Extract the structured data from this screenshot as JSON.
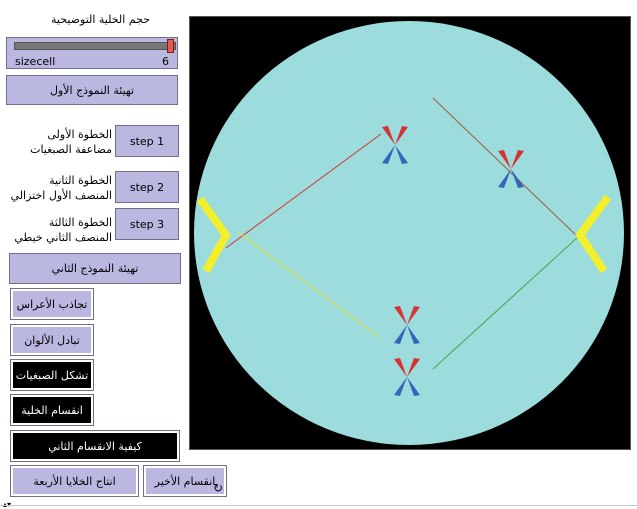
{
  "slider": {
    "title": "حجم الخلية التوضيحية",
    "variable": "sizecell",
    "value": "6",
    "fraction": 0.97
  },
  "buttons": {
    "setup_model_one": "تهيئة النموذج الأول",
    "step1": "step 1",
    "step2": "step 2",
    "step3": "step 3",
    "setup_model_two": "تهيئة النموذج الثاني",
    "attraction": "تجاذب الأعراس",
    "exchange_colors": "تبادل الألوان",
    "chromosome_formation": "تشكل الصبغيات",
    "cell_division": "انقسام الخلية",
    "second_division": "كيفية الانقسام الثاني",
    "last_division": "انقسام الأخير",
    "four_cells": "انتاج الخلايا الأربعة"
  },
  "step_labels": {
    "step1_line1": "الخطوة الأولى",
    "step1_line2": "مضاعفة الصبغيات",
    "step2_line1": "الخطوة الثانية",
    "step2_line2": "المنصف الأول اختزالي",
    "step3_line1": "الخطوة الثالثة",
    "step3_line2": "المنصف الثاني خيطي"
  },
  "icons": {
    "forever": "forever-loop-icon"
  },
  "colors": {
    "button": "#bab7e0",
    "dark_button": "#000000",
    "cell": "#9cdcdc",
    "world": "#000000",
    "pole": "#f2ef2c",
    "chrom_red": "#d63333",
    "chrom_blue": "#3366b8"
  }
}
